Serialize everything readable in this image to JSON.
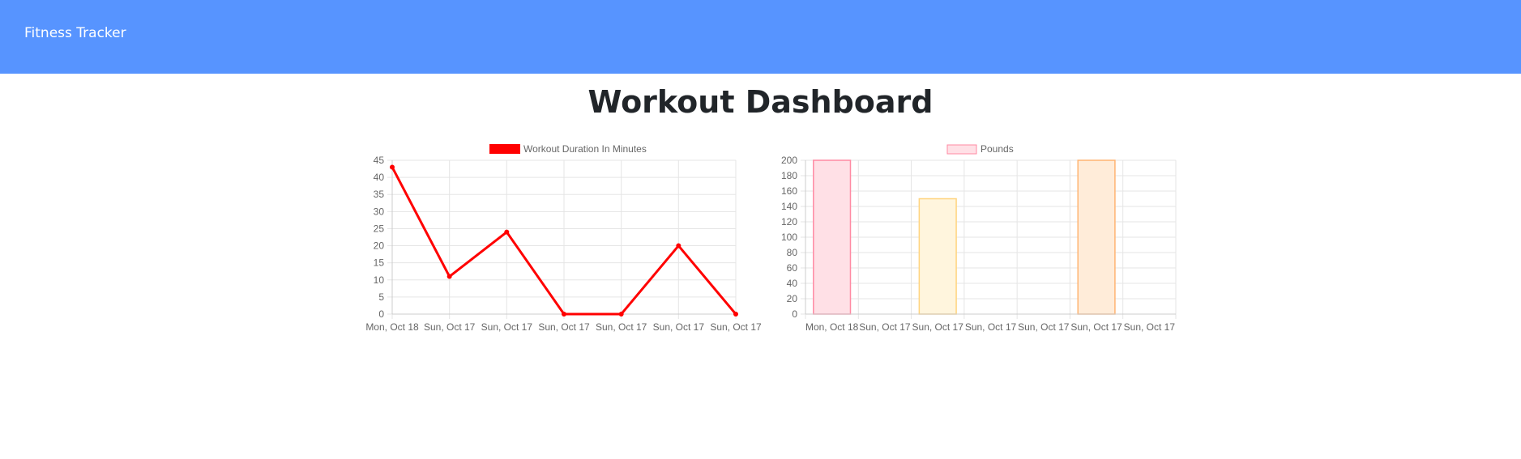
{
  "navbar": {
    "brand": "Fitness Tracker",
    "background": "#5794ff"
  },
  "page": {
    "title": "Workout Dashboard"
  },
  "chart_data": [
    {
      "type": "line",
      "legend": "Workout Duration In Minutes",
      "legend_position": "top",
      "color": "#ff0000",
      "categories": [
        "Mon, Oct 18",
        "Sun, Oct 17",
        "Sun, Oct 17",
        "Sun, Oct 17",
        "Sun, Oct 17",
        "Sun, Oct 17",
        "Sun, Oct 17"
      ],
      "series": [
        {
          "name": "Workout Duration In Minutes",
          "values": [
            43,
            11,
            24,
            0,
            0,
            20,
            0
          ]
        }
      ],
      "ylim": [
        0,
        45
      ],
      "yticks": [
        0,
        5,
        10,
        15,
        20,
        25,
        30,
        35,
        40,
        45
      ],
      "grid": true
    },
    {
      "type": "bar",
      "legend": "Pounds",
      "legend_position": "top",
      "legend_color": "#ffe0e6",
      "legend_border": "#ff8aa3",
      "categories": [
        "Mon, Oct 18",
        "Sun, Oct 17",
        "Sun, Oct 17",
        "Sun, Oct 17",
        "Sun, Oct 17",
        "Sun, Oct 17",
        "Sun, Oct 17"
      ],
      "series": [
        {
          "name": "Pounds",
          "values": [
            200,
            0,
            150,
            0,
            0,
            200,
            0
          ]
        }
      ],
      "bar_fill_colors": [
        "#ffe0e6",
        "#e3f2fd",
        "#fff5dd",
        "#e0f5f5",
        "#ede5ff",
        "#ffecd9",
        "#ffe0e6"
      ],
      "bar_border_colors": [
        "#ff8aa3",
        "#7cc3f5",
        "#ffd47f",
        "#7dd3d3",
        "#b69cff",
        "#ffb473",
        "#ff8aa3"
      ],
      "ylim": [
        0,
        200
      ],
      "yticks": [
        0,
        20,
        40,
        60,
        80,
        100,
        120,
        140,
        160,
        180,
        200
      ],
      "grid": true
    }
  ]
}
